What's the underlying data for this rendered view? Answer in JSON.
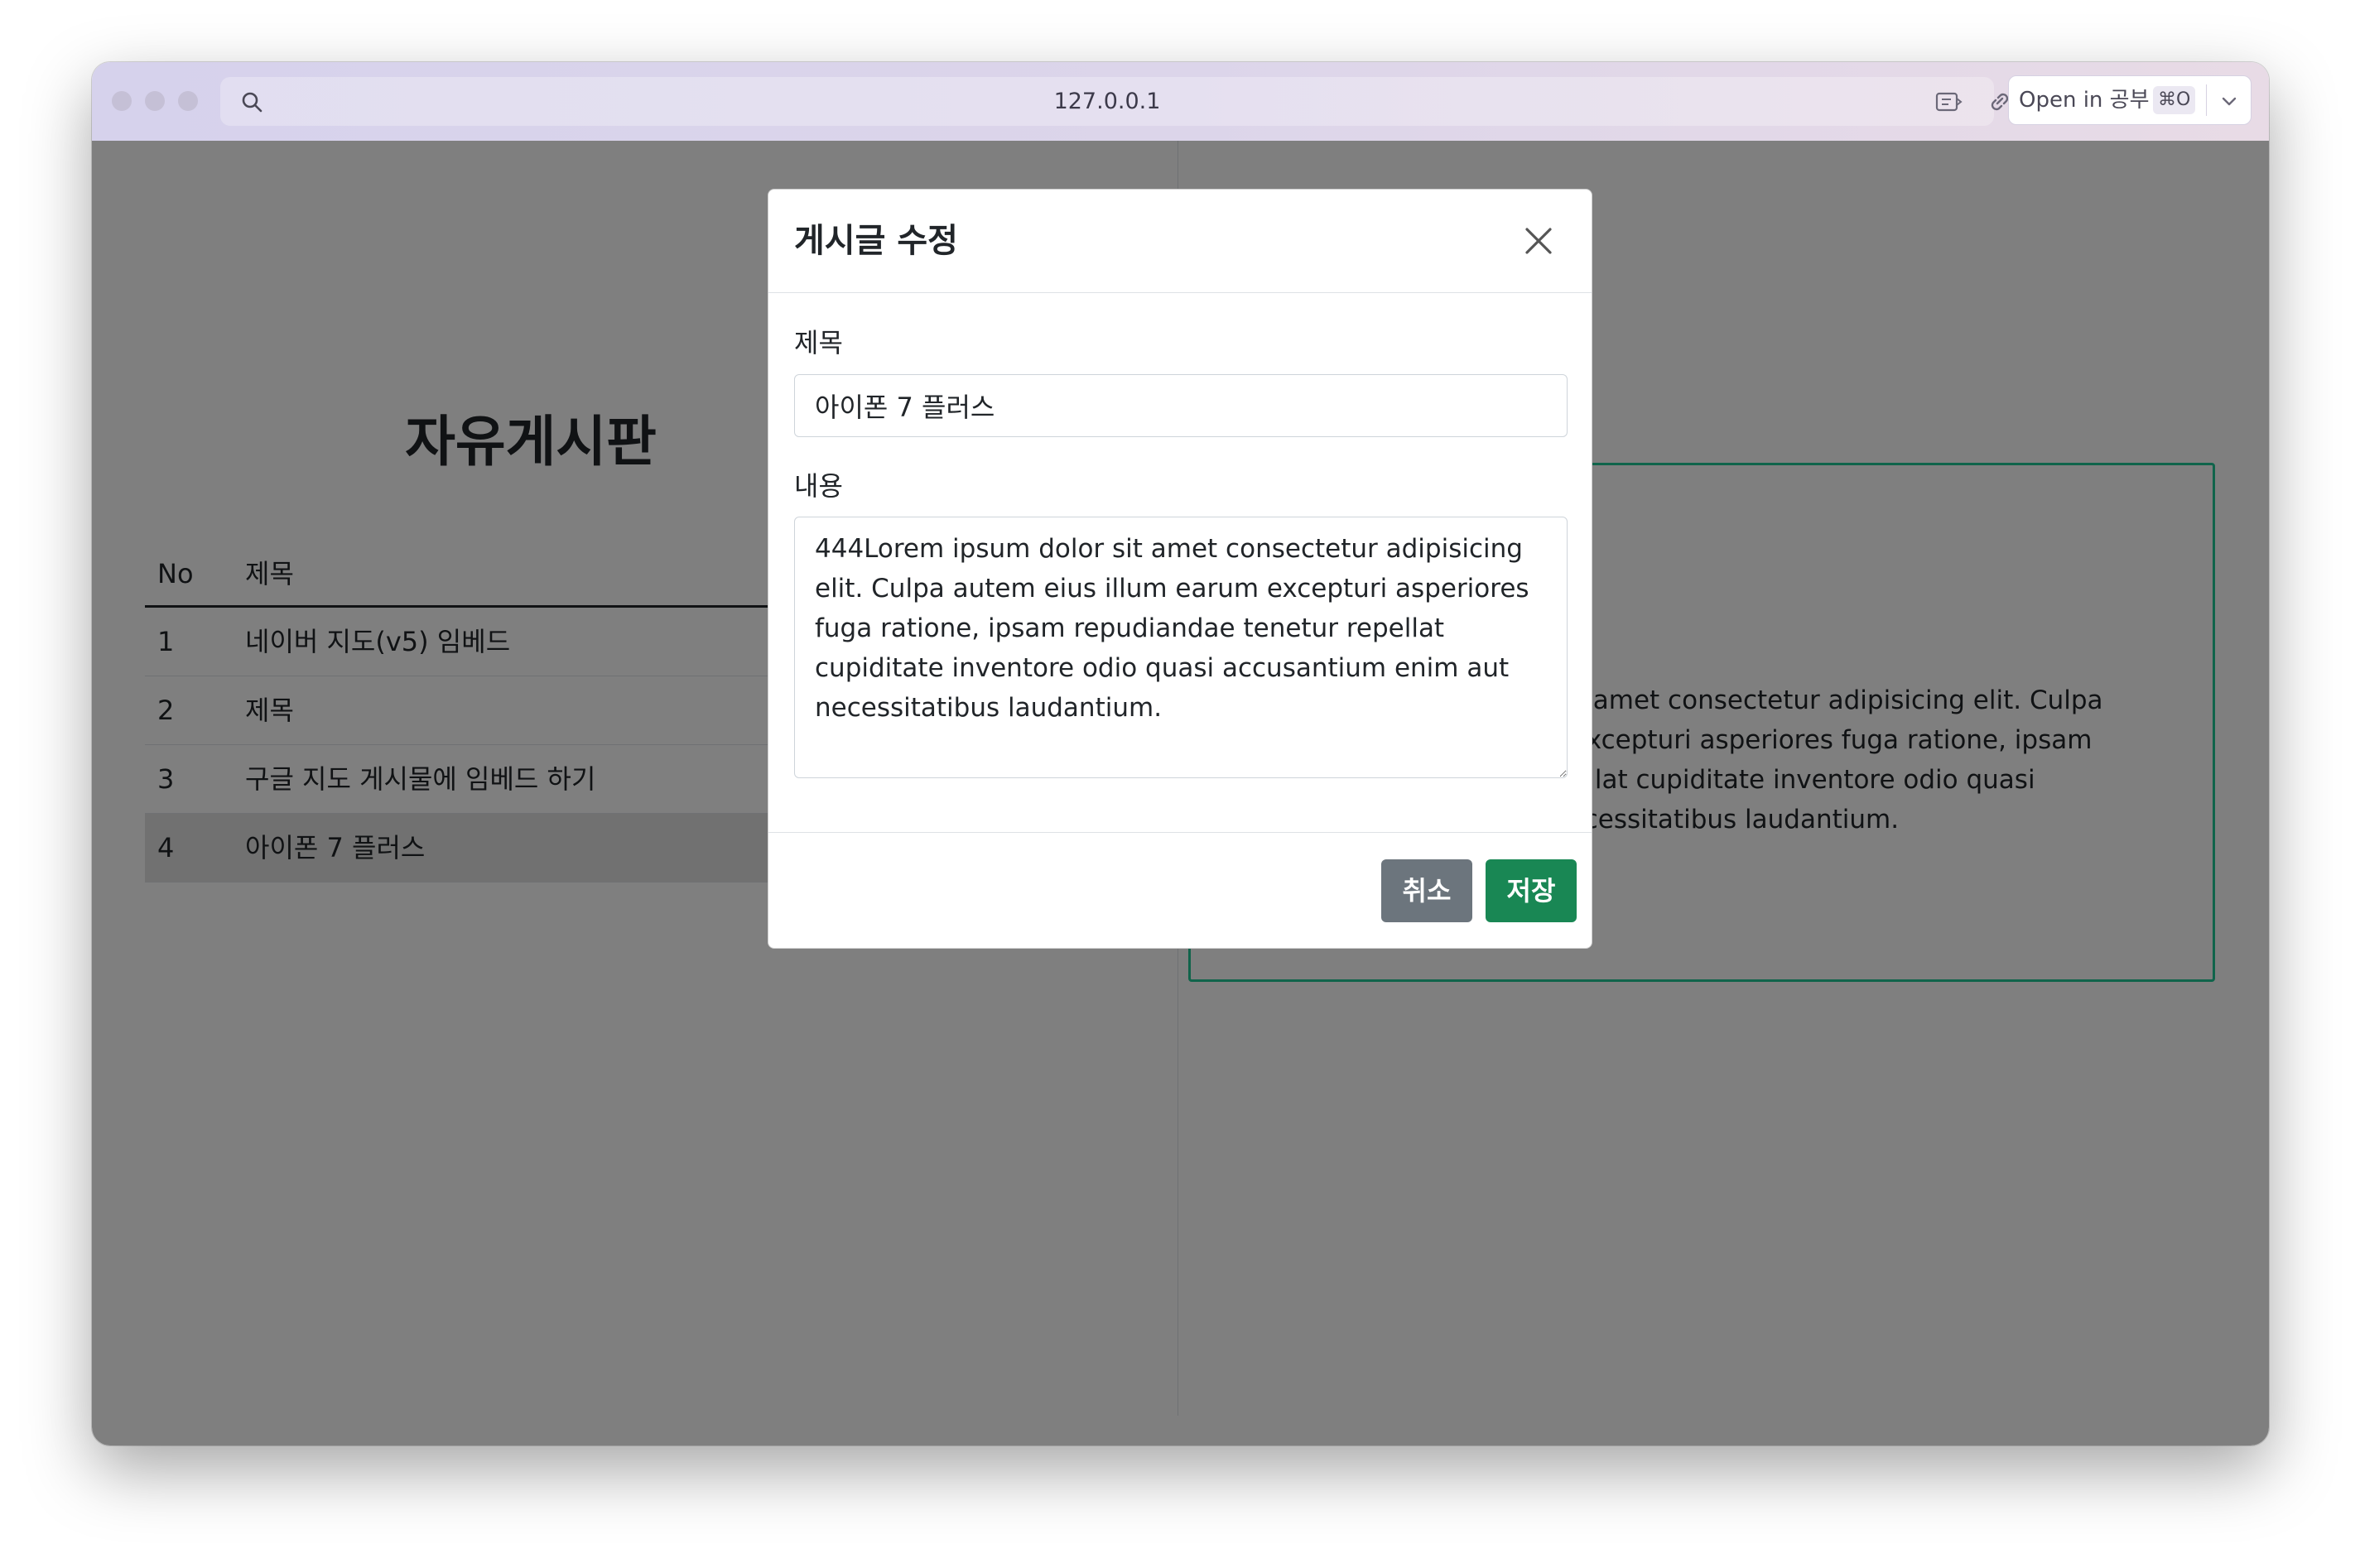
{
  "browser": {
    "url": "127.0.0.1",
    "open_in_label": "Open in 공부",
    "open_in_shortcut": "⌘O"
  },
  "board": {
    "title": "자유게시판",
    "columns": [
      "No",
      "제목"
    ],
    "rows": [
      {
        "no": "1",
        "title": "네이버 지도(v5) 임베드"
      },
      {
        "no": "2",
        "title": "제목"
      },
      {
        "no": "3",
        "title": "구글 지도 게시물에 임베드 하기"
      },
      {
        "no": "4",
        "title": "아이폰 7 플러스"
      }
    ],
    "selected_row": "4"
  },
  "detail": {
    "content": "444Lorem ipsum dolor sit amet consectetur adipisicing elit. Culpa autem eius illum earum excepturi asperiores fuga ratione, ipsam repudiandae tenetur repellat cupiditate inventore odio quasi accusantium enim aut necessitatibus laudantium."
  },
  "modal": {
    "title": "게시글 수정",
    "subject_label": "제목",
    "subject_value": "아이폰 7 플러스",
    "content_label": "내용",
    "content_value": "444Lorem ipsum dolor sit amet consectetur adipisicing elit. Culpa autem eius illum earum excepturi asperiores fuga ratione, ipsam repudiandae tenetur repellat cupiditate inventore odio quasi accusantium enim aut necessitatibus laudantium.",
    "cancel_label": "취소",
    "save_label": "저장"
  },
  "colors": {
    "accent_save": "#198754",
    "cancel": "#6c757d",
    "card_border": "#20c997"
  },
  "icons": {
    "close": "close-icon",
    "search": "search-icon",
    "reader": "reader-icon",
    "link": "link-icon",
    "chevron": "chevron-down-icon"
  }
}
